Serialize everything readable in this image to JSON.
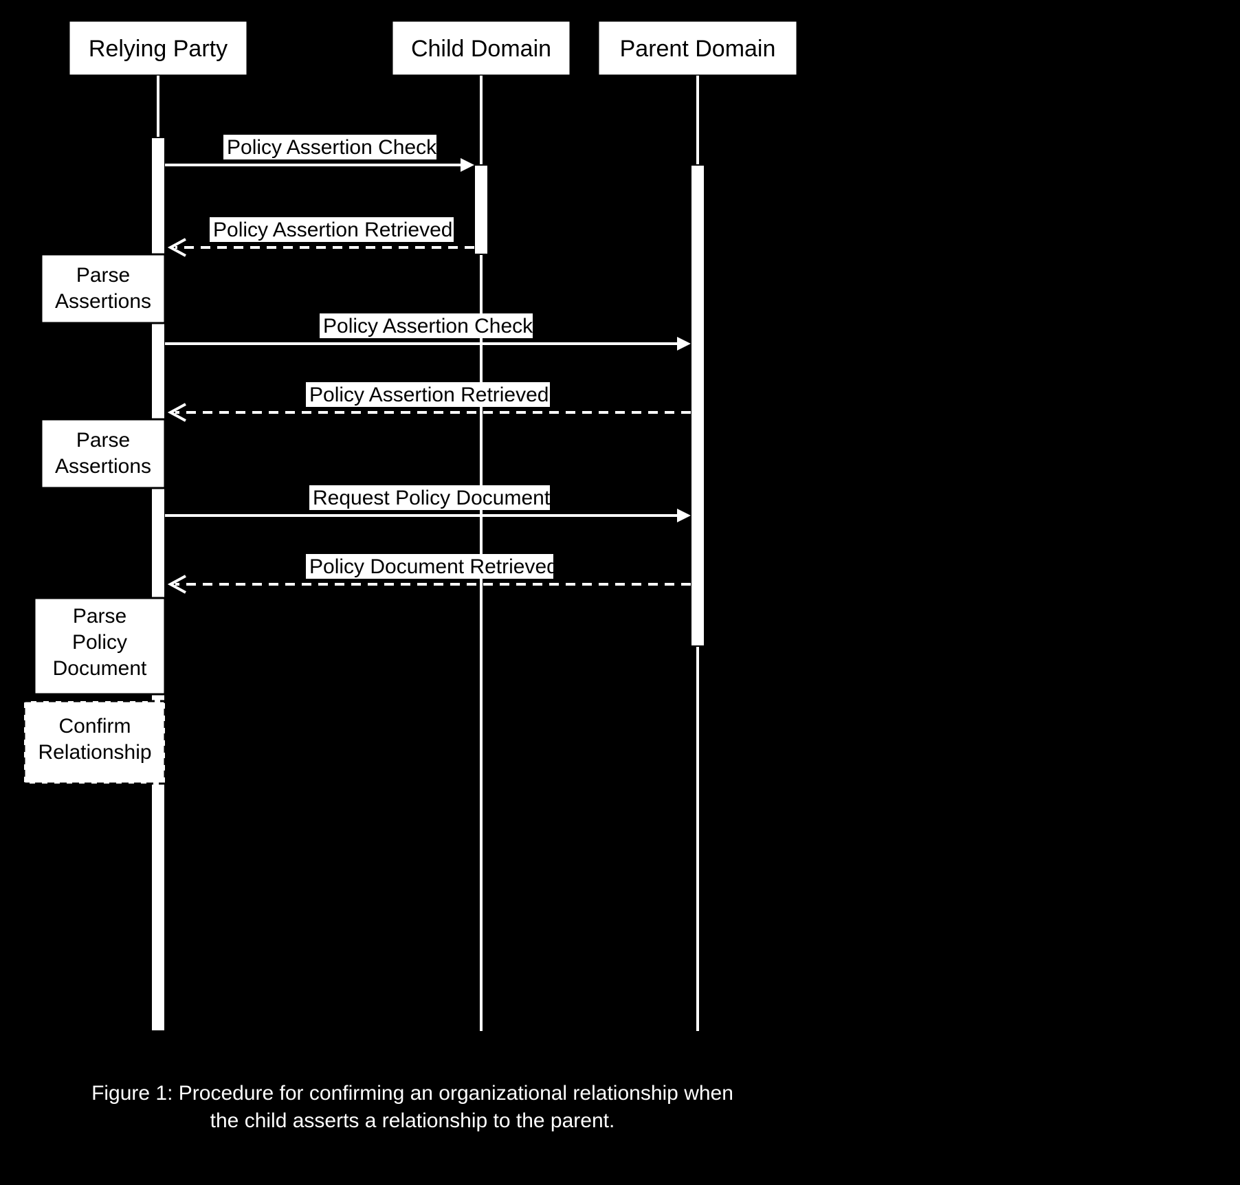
{
  "participants": {
    "relying_party": "Relying Party",
    "child_domain": "Child Domain",
    "parent_domain": "Parent Domain"
  },
  "messages": {
    "m1": "Policy Assertion Check",
    "m2": "Policy Assertion Retrieved",
    "m3": "Policy Assertion Check",
    "m4": "Policy Assertion Retrieved",
    "m5": "Request Policy Document",
    "m6": "Policy Document Retrieved"
  },
  "actions": {
    "a1_l1": "Parse",
    "a1_l2": "Assertions",
    "a2_l1": "Parse",
    "a2_l2": "Assertions",
    "a3_l1": "Parse",
    "a3_l2": "Policy",
    "a3_l3": "Document",
    "a4_l1": "Confirm",
    "a4_l2": "Relationship"
  },
  "caption_l1": "Figure 1: Procedure for confirming an organizational relationship when",
  "caption_l2": "the child asserts a relationship to the parent.",
  "colors": {
    "bg": "#000000",
    "fg": "#ffffff"
  }
}
